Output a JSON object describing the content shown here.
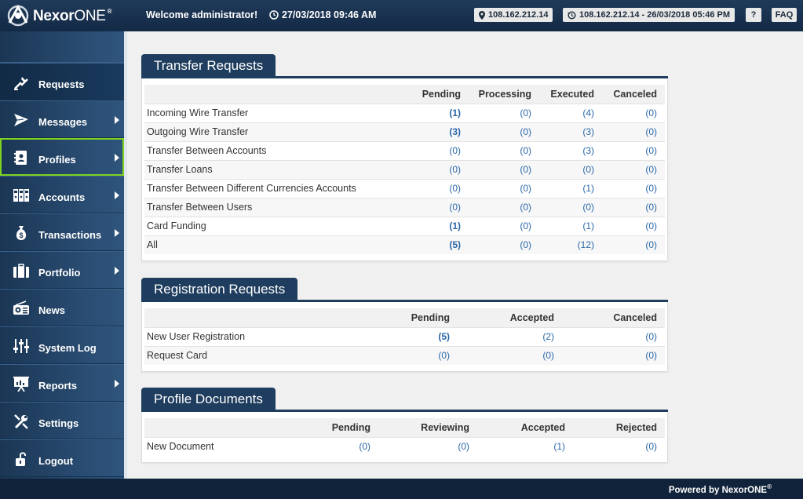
{
  "header": {
    "logo_brand": "Nexor",
    "logo_suffix": "ONE",
    "logo_mark": "®",
    "welcome_prefix": "Welcome ",
    "welcome_user": "administrator!",
    "datetime": "27/03/2018 09:46 AM",
    "ip": "108.162.212.14",
    "last_login": "108.162.212.14 - 26/03/2018 05:46 PM",
    "help_label": "?",
    "faq_label": "FAQ"
  },
  "sidebar": {
    "items": [
      {
        "label": "Requests",
        "icon": "requests-icon",
        "has_submenu": false
      },
      {
        "label": "Messages",
        "icon": "send-icon",
        "has_submenu": true
      },
      {
        "label": "Profiles",
        "icon": "address-book-icon",
        "has_submenu": true
      },
      {
        "label": "Accounts",
        "icon": "binders-icon",
        "has_submenu": true
      },
      {
        "label": "Transactions",
        "icon": "money-bag-icon",
        "has_submenu": true
      },
      {
        "label": "Portfolio",
        "icon": "briefcase-icon",
        "has_submenu": true
      },
      {
        "label": "News",
        "icon": "radio-icon",
        "has_submenu": false
      },
      {
        "label": "System Log",
        "icon": "sliders-icon",
        "has_submenu": false
      },
      {
        "label": "Reports",
        "icon": "presentation-icon",
        "has_submenu": true
      },
      {
        "label": "Settings",
        "icon": "wrench-icon",
        "has_submenu": false
      },
      {
        "label": "Logout",
        "icon": "unlock-icon",
        "has_submenu": false
      }
    ]
  },
  "transfer_requests": {
    "title": "Transfer Requests",
    "columns": [
      "",
      "Pending",
      "Processing",
      "Executed",
      "Canceled"
    ],
    "rows": [
      {
        "name": "Incoming Wire Transfer",
        "values": [
          "(1)",
          "(0)",
          "(4)",
          "(0)"
        ],
        "bold_pending": true
      },
      {
        "name": "Outgoing Wire Transfer",
        "values": [
          "(3)",
          "(0)",
          "(3)",
          "(0)"
        ],
        "bold_pending": true
      },
      {
        "name": "Transfer Between Accounts",
        "values": [
          "(0)",
          "(0)",
          "(3)",
          "(0)"
        ],
        "bold_pending": false
      },
      {
        "name": "Transfer Loans",
        "values": [
          "(0)",
          "(0)",
          "(0)",
          "(0)"
        ],
        "bold_pending": false
      },
      {
        "name": "Transfer Between Different Currencies Accounts",
        "values": [
          "(0)",
          "(0)",
          "(1)",
          "(0)"
        ],
        "bold_pending": false
      },
      {
        "name": "Transfer Between Users",
        "values": [
          "(0)",
          "(0)",
          "(0)",
          "(0)"
        ],
        "bold_pending": false
      },
      {
        "name": "Card Funding",
        "values": [
          "(1)",
          "(0)",
          "(1)",
          "(0)"
        ],
        "bold_pending": true
      },
      {
        "name": "All",
        "values": [
          "(5)",
          "(0)",
          "(12)",
          "(0)"
        ],
        "bold_pending": true
      }
    ]
  },
  "registration_requests": {
    "title": "Registration Requests",
    "columns": [
      "",
      "Pending",
      "Accepted",
      "Canceled"
    ],
    "rows": [
      {
        "name": "New User Registration",
        "values": [
          "(5)",
          "(2)",
          "(0)"
        ],
        "bold_pending": true
      },
      {
        "name": "Request Card",
        "values": [
          "(0)",
          "(0)",
          "(0)"
        ],
        "bold_pending": false
      }
    ]
  },
  "profile_documents": {
    "title": "Profile Documents",
    "columns": [
      "",
      "Pending",
      "Reviewing",
      "Accepted",
      "Rejected"
    ],
    "rows": [
      {
        "name": "New Document",
        "values": [
          "(0)",
          "(0)",
          "(1)",
          "(0)"
        ],
        "bold_pending": false
      }
    ]
  },
  "footer": {
    "text": "Powered by NexorONE",
    "mark": "®"
  },
  "colors": {
    "topbar": "#132a45",
    "sidebar": "#2a4d73",
    "panel_header": "#1f3d5e",
    "link": "#2a67a8",
    "active_outline": "#7ed321"
  }
}
